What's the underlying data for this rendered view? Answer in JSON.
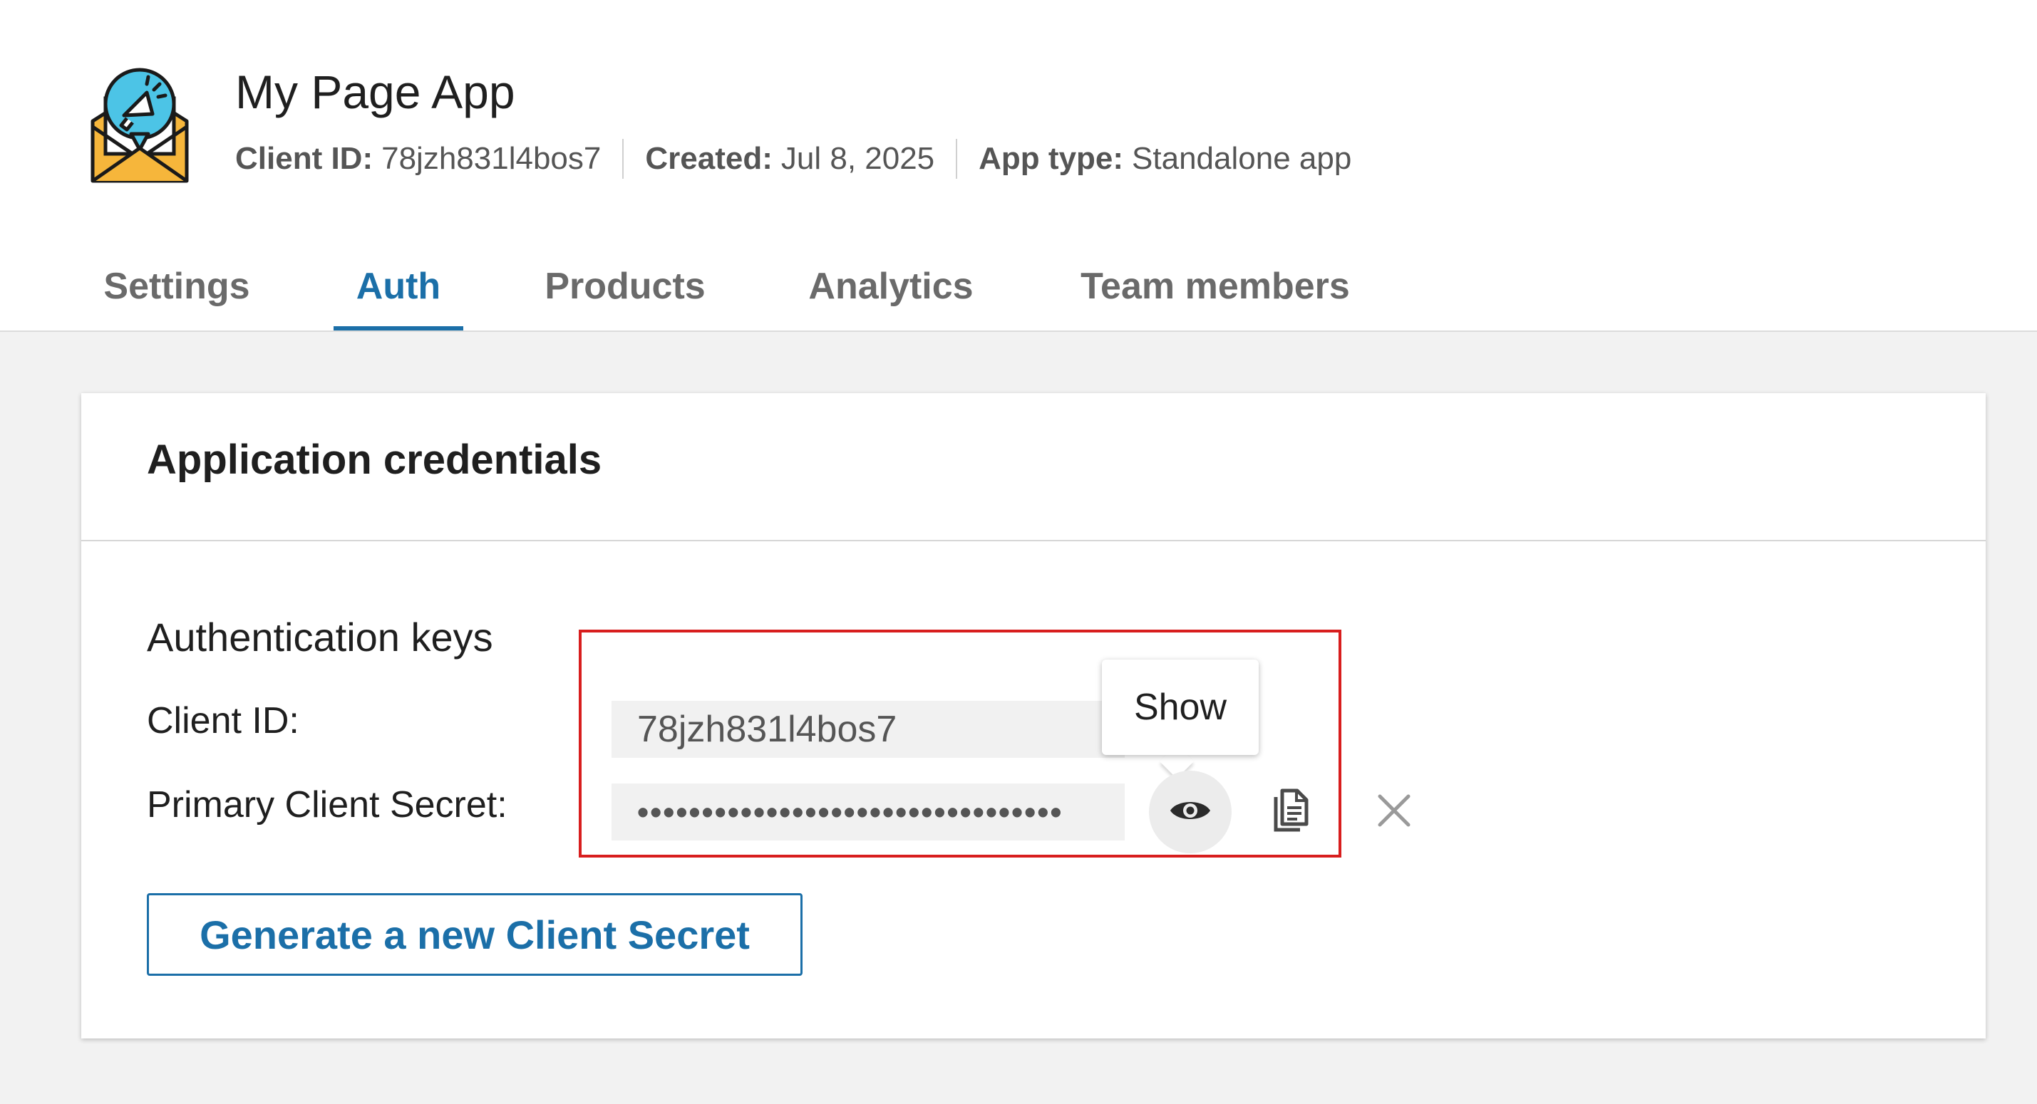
{
  "app": {
    "title": "My Page App",
    "logo_icon": "megaphone-envelope-icon",
    "meta": {
      "client_id_label": "Client ID:",
      "client_id_value": "78jzh831l4bos7",
      "created_label": "Created:",
      "created_value": "Jul 8, 2025",
      "app_type_label": "App type:",
      "app_type_value": "Standalone app"
    }
  },
  "tabs": [
    {
      "label": "Settings",
      "active": false
    },
    {
      "label": "Auth",
      "active": true
    },
    {
      "label": "Products",
      "active": false
    },
    {
      "label": "Analytics",
      "active": false
    },
    {
      "label": "Team members",
      "active": false
    }
  ],
  "credentials": {
    "title": "Application credentials",
    "section_label": "Authentication keys",
    "client_id_label": "Client ID:",
    "client_id_value": "78jzh831l4bos7",
    "secret_label": "Primary Client Secret:",
    "secret_masked": "•••••••••••••••••••••••••••••••••",
    "tooltip": "Show",
    "icons": {
      "show": "eye-icon",
      "copy": "copy-icon",
      "close": "close-icon"
    },
    "generate_button": "Generate a new Client Secret"
  },
  "colors": {
    "accent": "#1b6fa8",
    "highlight": "#d81e1e",
    "background": "#f2f2f2"
  }
}
